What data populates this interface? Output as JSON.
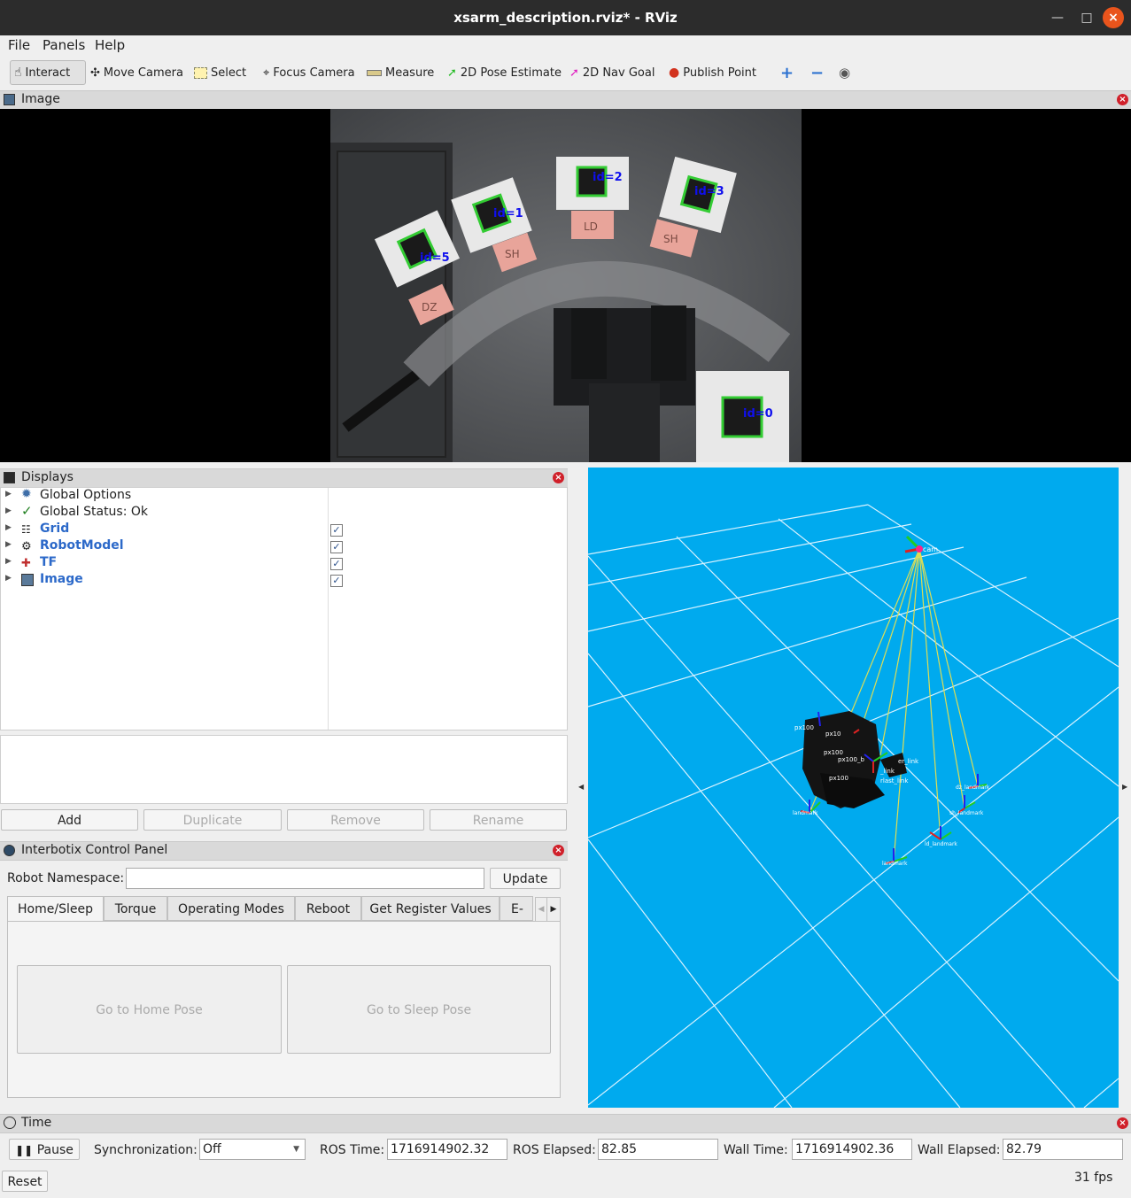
{
  "window": {
    "title": "xsarm_description.rviz* - RViz"
  },
  "menu": {
    "file": "File",
    "panels": "Panels",
    "help": "Help"
  },
  "toolbar": {
    "interact": "Interact",
    "move_camera": "Move Camera",
    "select": "Select",
    "focus_camera": "Focus Camera",
    "measure": "Measure",
    "pose_estimate": "2D Pose Estimate",
    "nav_goal": "2D Nav Goal",
    "publish_point": "Publish Point"
  },
  "image_panel": {
    "title": "Image",
    "markers": [
      "id=5",
      "id=1",
      "id=2",
      "id=3",
      "id=0"
    ],
    "tags": [
      "DZ",
      "SH",
      "LD",
      "SH"
    ]
  },
  "displays": {
    "title": "Displays",
    "items": [
      {
        "label": "Global Options",
        "checked": null
      },
      {
        "label": "Global Status: Ok",
        "checked": null
      },
      {
        "label": "Grid",
        "checked": true
      },
      {
        "label": "RobotModel",
        "checked": true
      },
      {
        "label": "TF",
        "checked": true
      },
      {
        "label": "Image",
        "checked": true
      }
    ],
    "buttons": {
      "add": "Add",
      "duplicate": "Duplicate",
      "remove": "Remove",
      "rename": "Rename"
    }
  },
  "control_panel": {
    "title": "Interbotix Control Panel",
    "namespace_label": "Robot Namespace:",
    "namespace_value": "",
    "update": "Update",
    "tabs": [
      "Home/Sleep",
      "Torque",
      "Operating Modes",
      "Reboot",
      "Get Register Values",
      "E-St"
    ],
    "home_pose": "Go to Home Pose",
    "sleep_pose": "Go to Sleep Pose"
  },
  "viewport": {
    "background": "#00aaee",
    "frame_labels": [
      "cam",
      "px100",
      "px10",
      "px100",
      "px100",
      "px100_b",
      "er_link",
      "_link",
      "rlast_link",
      "landmark",
      "ld_landmark",
      "sh_landmark",
      "dz_landmark"
    ]
  },
  "time": {
    "title": "Time",
    "pause": "Pause",
    "sync_label": "Synchronization:",
    "sync_value": "Off",
    "ros_time_label": "ROS Time:",
    "ros_time": "1716914902.32",
    "ros_elapsed_label": "ROS Elapsed:",
    "ros_elapsed": "82.85",
    "wall_time_label": "Wall Time:",
    "wall_time": "1716914902.36",
    "wall_elapsed_label": "Wall Elapsed:",
    "wall_elapsed": "82.79",
    "reset": "Reset",
    "fps": "31 fps"
  }
}
